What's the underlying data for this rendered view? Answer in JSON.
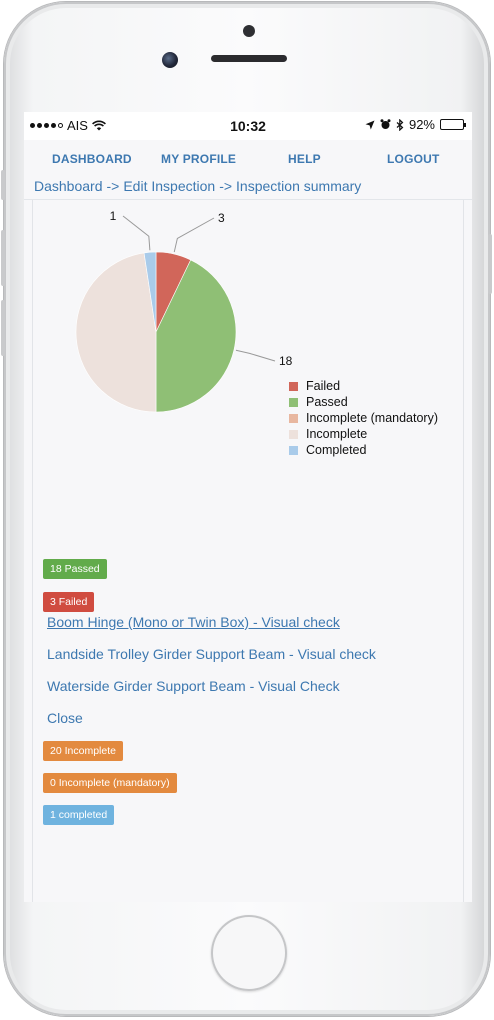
{
  "status_bar": {
    "carrier": "AIS",
    "time": "10:32",
    "battery": "92%",
    "battery_level": 0.92
  },
  "nav": {
    "links": [
      "DASHBOARD",
      "MY PROFILE",
      "HELP",
      "LOGOUT"
    ]
  },
  "breadcrumb": [
    "Dashboard",
    "->",
    "Edit Inspection",
    "->",
    "Inspection summary"
  ],
  "chart_data": {
    "type": "pie",
    "legend_position": "right",
    "slices": [
      {
        "name": "Failed",
        "value": 3,
        "color": "#d1665a"
      },
      {
        "name": "Passed",
        "value": 18,
        "color": "#8fbf75"
      },
      {
        "name": "Incomplete (mandatory)",
        "value": 0,
        "color": "#e8b7a0"
      },
      {
        "name": "Incomplete",
        "value": 20,
        "color": "#ede1dc"
      },
      {
        "name": "Completed",
        "value": 1,
        "color": "#a9cbea"
      }
    ],
    "data_labels": [
      "1",
      "3",
      "18"
    ]
  },
  "badges": {
    "passed": {
      "text": "18 Passed",
      "color": "#62ab4b"
    },
    "failed": {
      "text": "3 Failed",
      "color": "#d04c40"
    },
    "incomplete": {
      "text": "20 Incomplete",
      "color": "#e38a3f"
    },
    "incomplete_mandatory": {
      "text": "0 Incomplete (mandatory)",
      "color": "#e38a3f"
    },
    "completed": {
      "text": "1 completed",
      "color": "#6fb3df"
    }
  },
  "failed_items": [
    "Boom Hinge (Mono or Twin Box) - Visual check",
    "Landside Trolley Girder Support Beam - Visual check",
    "Waterside Girder Support Beam - Visual Check"
  ],
  "close_label": "Close"
}
